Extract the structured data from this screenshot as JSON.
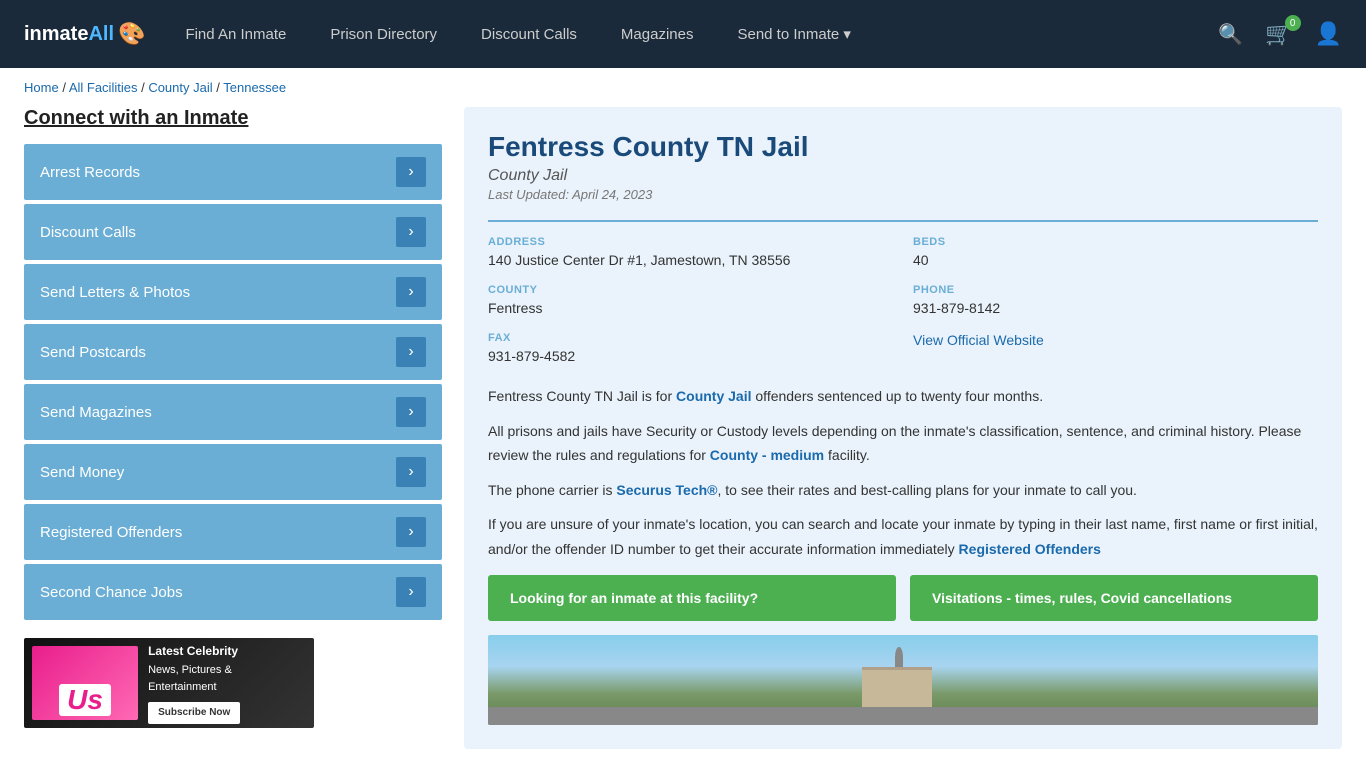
{
  "nav": {
    "logo_text": "inmate",
    "logo_all": "All",
    "links": [
      {
        "label": "Find An Inmate",
        "id": "find-inmate"
      },
      {
        "label": "Prison Directory",
        "id": "prison-directory"
      },
      {
        "label": "Discount Calls",
        "id": "discount-calls"
      },
      {
        "label": "Magazines",
        "id": "magazines"
      },
      {
        "label": "Send to Inmate",
        "id": "send-to-inmate"
      }
    ],
    "cart_count": "0",
    "send_to_inmate": "Send to Inmate ▾"
  },
  "breadcrumb": {
    "home": "Home",
    "all_facilities": "All Facilities",
    "county_jail": "County Jail",
    "state": "Tennessee"
  },
  "sidebar": {
    "title": "Connect with an Inmate",
    "items": [
      {
        "label": "Arrest Records",
        "id": "arrest-records"
      },
      {
        "label": "Discount Calls",
        "id": "discount-calls"
      },
      {
        "label": "Send Letters & Photos",
        "id": "send-letters"
      },
      {
        "label": "Send Postcards",
        "id": "send-postcards"
      },
      {
        "label": "Send Magazines",
        "id": "send-magazines"
      },
      {
        "label": "Send Money",
        "id": "send-money"
      },
      {
        "label": "Registered Offenders",
        "id": "registered-offenders"
      },
      {
        "label": "Second Chance Jobs",
        "id": "second-chance-jobs"
      }
    ],
    "ad": {
      "brand": "Us",
      "line1": "Latest Celebrity",
      "line2": "News, Pictures &",
      "line3": "Entertainment",
      "button": "Subscribe Now"
    }
  },
  "facility": {
    "title": "Fentress County TN Jail",
    "type": "County Jail",
    "last_updated": "Last Updated: April 24, 2023",
    "address_label": "ADDRESS",
    "address_value": "140 Justice Center Dr #1, Jamestown, TN 38556",
    "beds_label": "BEDS",
    "beds_value": "40",
    "county_label": "COUNTY",
    "county_value": "Fentress",
    "phone_label": "PHONE",
    "phone_value": "931-879-8142",
    "fax_label": "FAX",
    "fax_value": "931-879-4582",
    "website_label": "View Official Website",
    "desc1": "Fentress County TN Jail is for ",
    "desc1_link": "County Jail",
    "desc1_end": " offenders sentenced up to twenty four months.",
    "desc2": "All prisons and jails have Security or Custody levels depending on the inmate's classification, sentence, and criminal history. Please review the rules and regulations for ",
    "desc2_link": "County - medium",
    "desc2_end": " facility.",
    "desc3": "The phone carrier is ",
    "desc3_link": "Securus Tech®",
    "desc3_end": ", to see their rates and best-calling plans for your inmate to call you.",
    "desc4": "If you are unsure of your inmate's location, you can search and locate your inmate by typing in their last name, first name or first initial, and/or the offender ID number to get their accurate information immediately ",
    "desc4_link": "Registered Offenders",
    "btn1": "Looking for an inmate at this facility?",
    "btn2": "Visitations - times, rules, Covid cancellations"
  }
}
